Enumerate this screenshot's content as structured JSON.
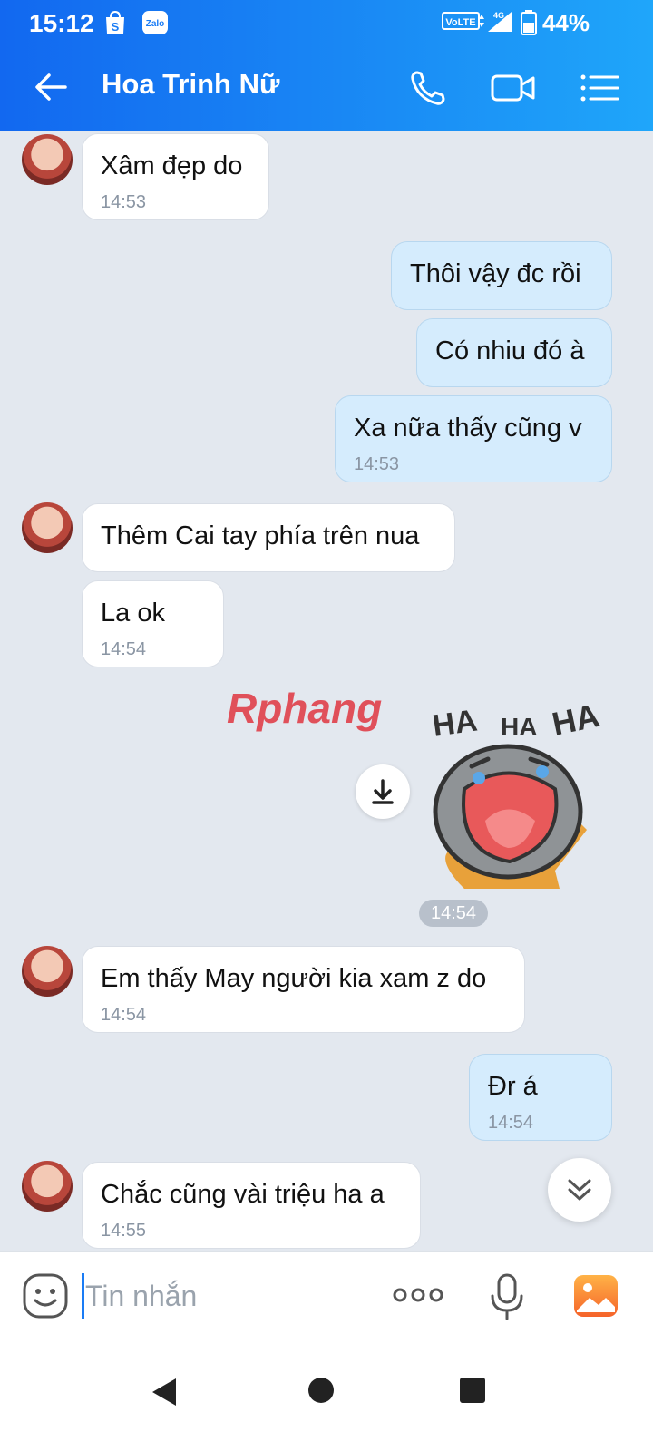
{
  "status_bar": {
    "time": "15:12",
    "battery": "44%",
    "network": "4G",
    "volte": "VoLTE"
  },
  "header": {
    "title": "Hoa Trinh Nữ"
  },
  "messages": [
    {
      "side": "in",
      "text": "Xâm đẹp do",
      "time": "14:53"
    },
    {
      "side": "out",
      "text": "Thôi vậy đc rồi",
      "time": ""
    },
    {
      "side": "out",
      "text": "Có nhiu đó à",
      "time": ""
    },
    {
      "side": "out",
      "text": "Xa nữa thấy cũng v",
      "time": "14:53"
    },
    {
      "side": "in",
      "text": "Thêm Cai tay phía trên nua",
      "time": ""
    },
    {
      "side": "in",
      "text": "La ok",
      "time": "14:54"
    },
    {
      "side": "out",
      "text": "Em thấy May người kia xam z do",
      "time": "14:54"
    },
    {
      "side": "out",
      "text": "Đr á",
      "time": "14:54"
    },
    {
      "side": "in",
      "text": "Chắc cũng vài triệu ha a",
      "time": "14:55"
    }
  ],
  "sticker": {
    "watermark": "Rphang",
    "ha1": "HA",
    "ha2": "HA",
    "ha3": "HA",
    "time": "14:54"
  },
  "input": {
    "placeholder": "Tin nhắn"
  },
  "colors": {
    "header_start": "#1268f0",
    "header_end": "#1fa6fa",
    "outgoing_bubble": "#d5ecfd",
    "incoming_bubble": "#ffffff",
    "chat_background": "#e3e8ef"
  }
}
